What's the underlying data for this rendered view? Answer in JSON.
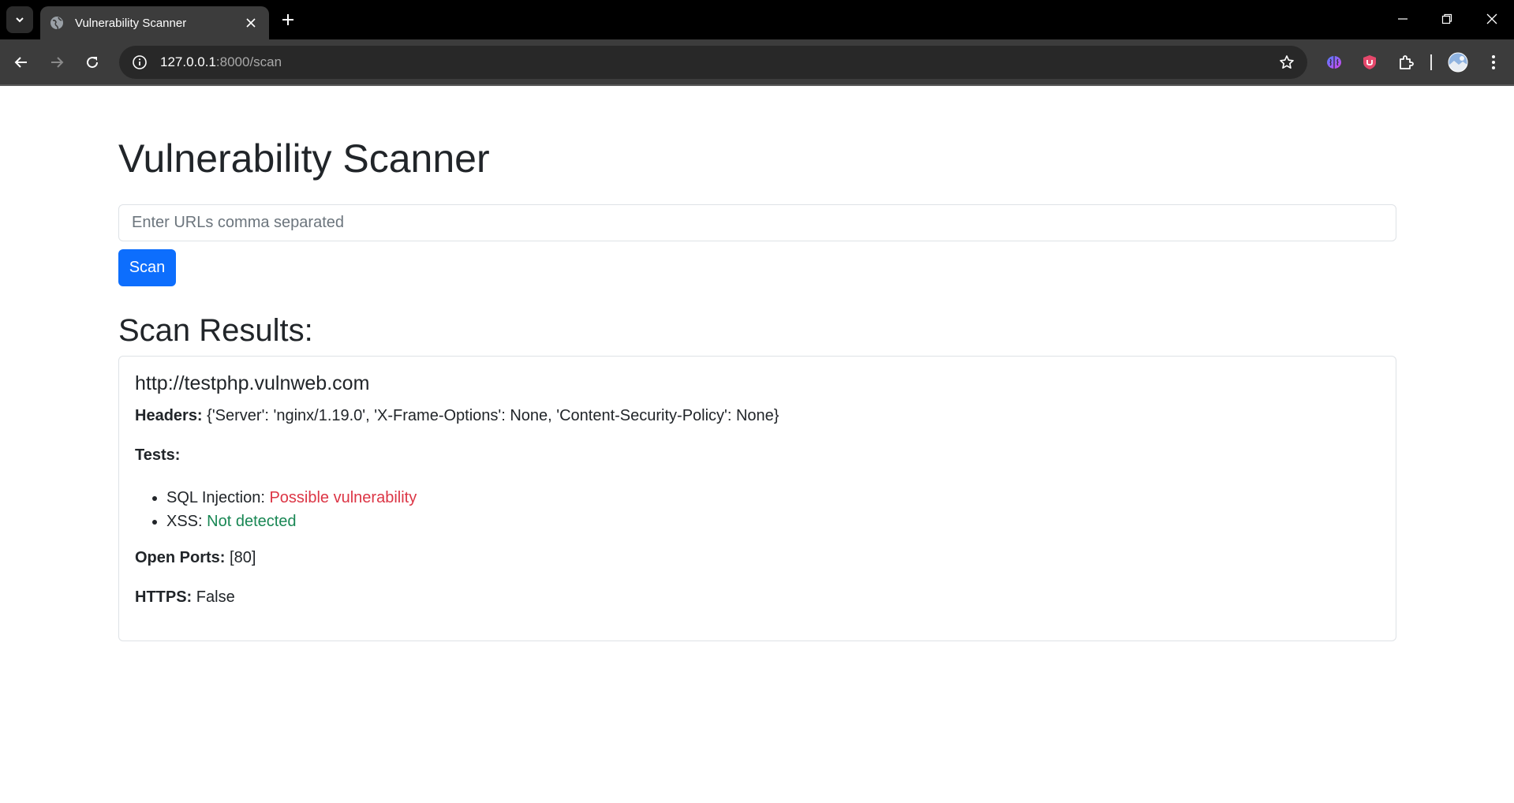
{
  "browser": {
    "tab_title": "Vulnerability Scanner",
    "url_host": "127.0.0.1",
    "url_path": ":8000/scan"
  },
  "page": {
    "title": "Vulnerability Scanner",
    "url_input_placeholder": "Enter URLs comma separated",
    "url_input_value": "",
    "scan_button_label": "Scan",
    "results_heading": "Scan Results:"
  },
  "results": [
    {
      "url": "http://testphp.vulnweb.com",
      "headers_label": "Headers:",
      "headers_value": "{'Server': 'nginx/1.19.0', 'X-Frame-Options': None, 'Content-Security-Policy': None}",
      "tests_label": "Tests:",
      "tests": [
        {
          "name": "SQL Injection:",
          "result": "Possible vulnerability",
          "status": "danger"
        },
        {
          "name": "XSS:",
          "result": "Not detected",
          "status": "success"
        }
      ],
      "open_ports_label": "Open Ports:",
      "open_ports_value": "[80]",
      "https_label": "HTTPS:",
      "https_value": "False"
    }
  ],
  "colors": {
    "primary": "#0d6efd",
    "danger": "#dc3545",
    "success": "#198754",
    "text": "#212529"
  }
}
